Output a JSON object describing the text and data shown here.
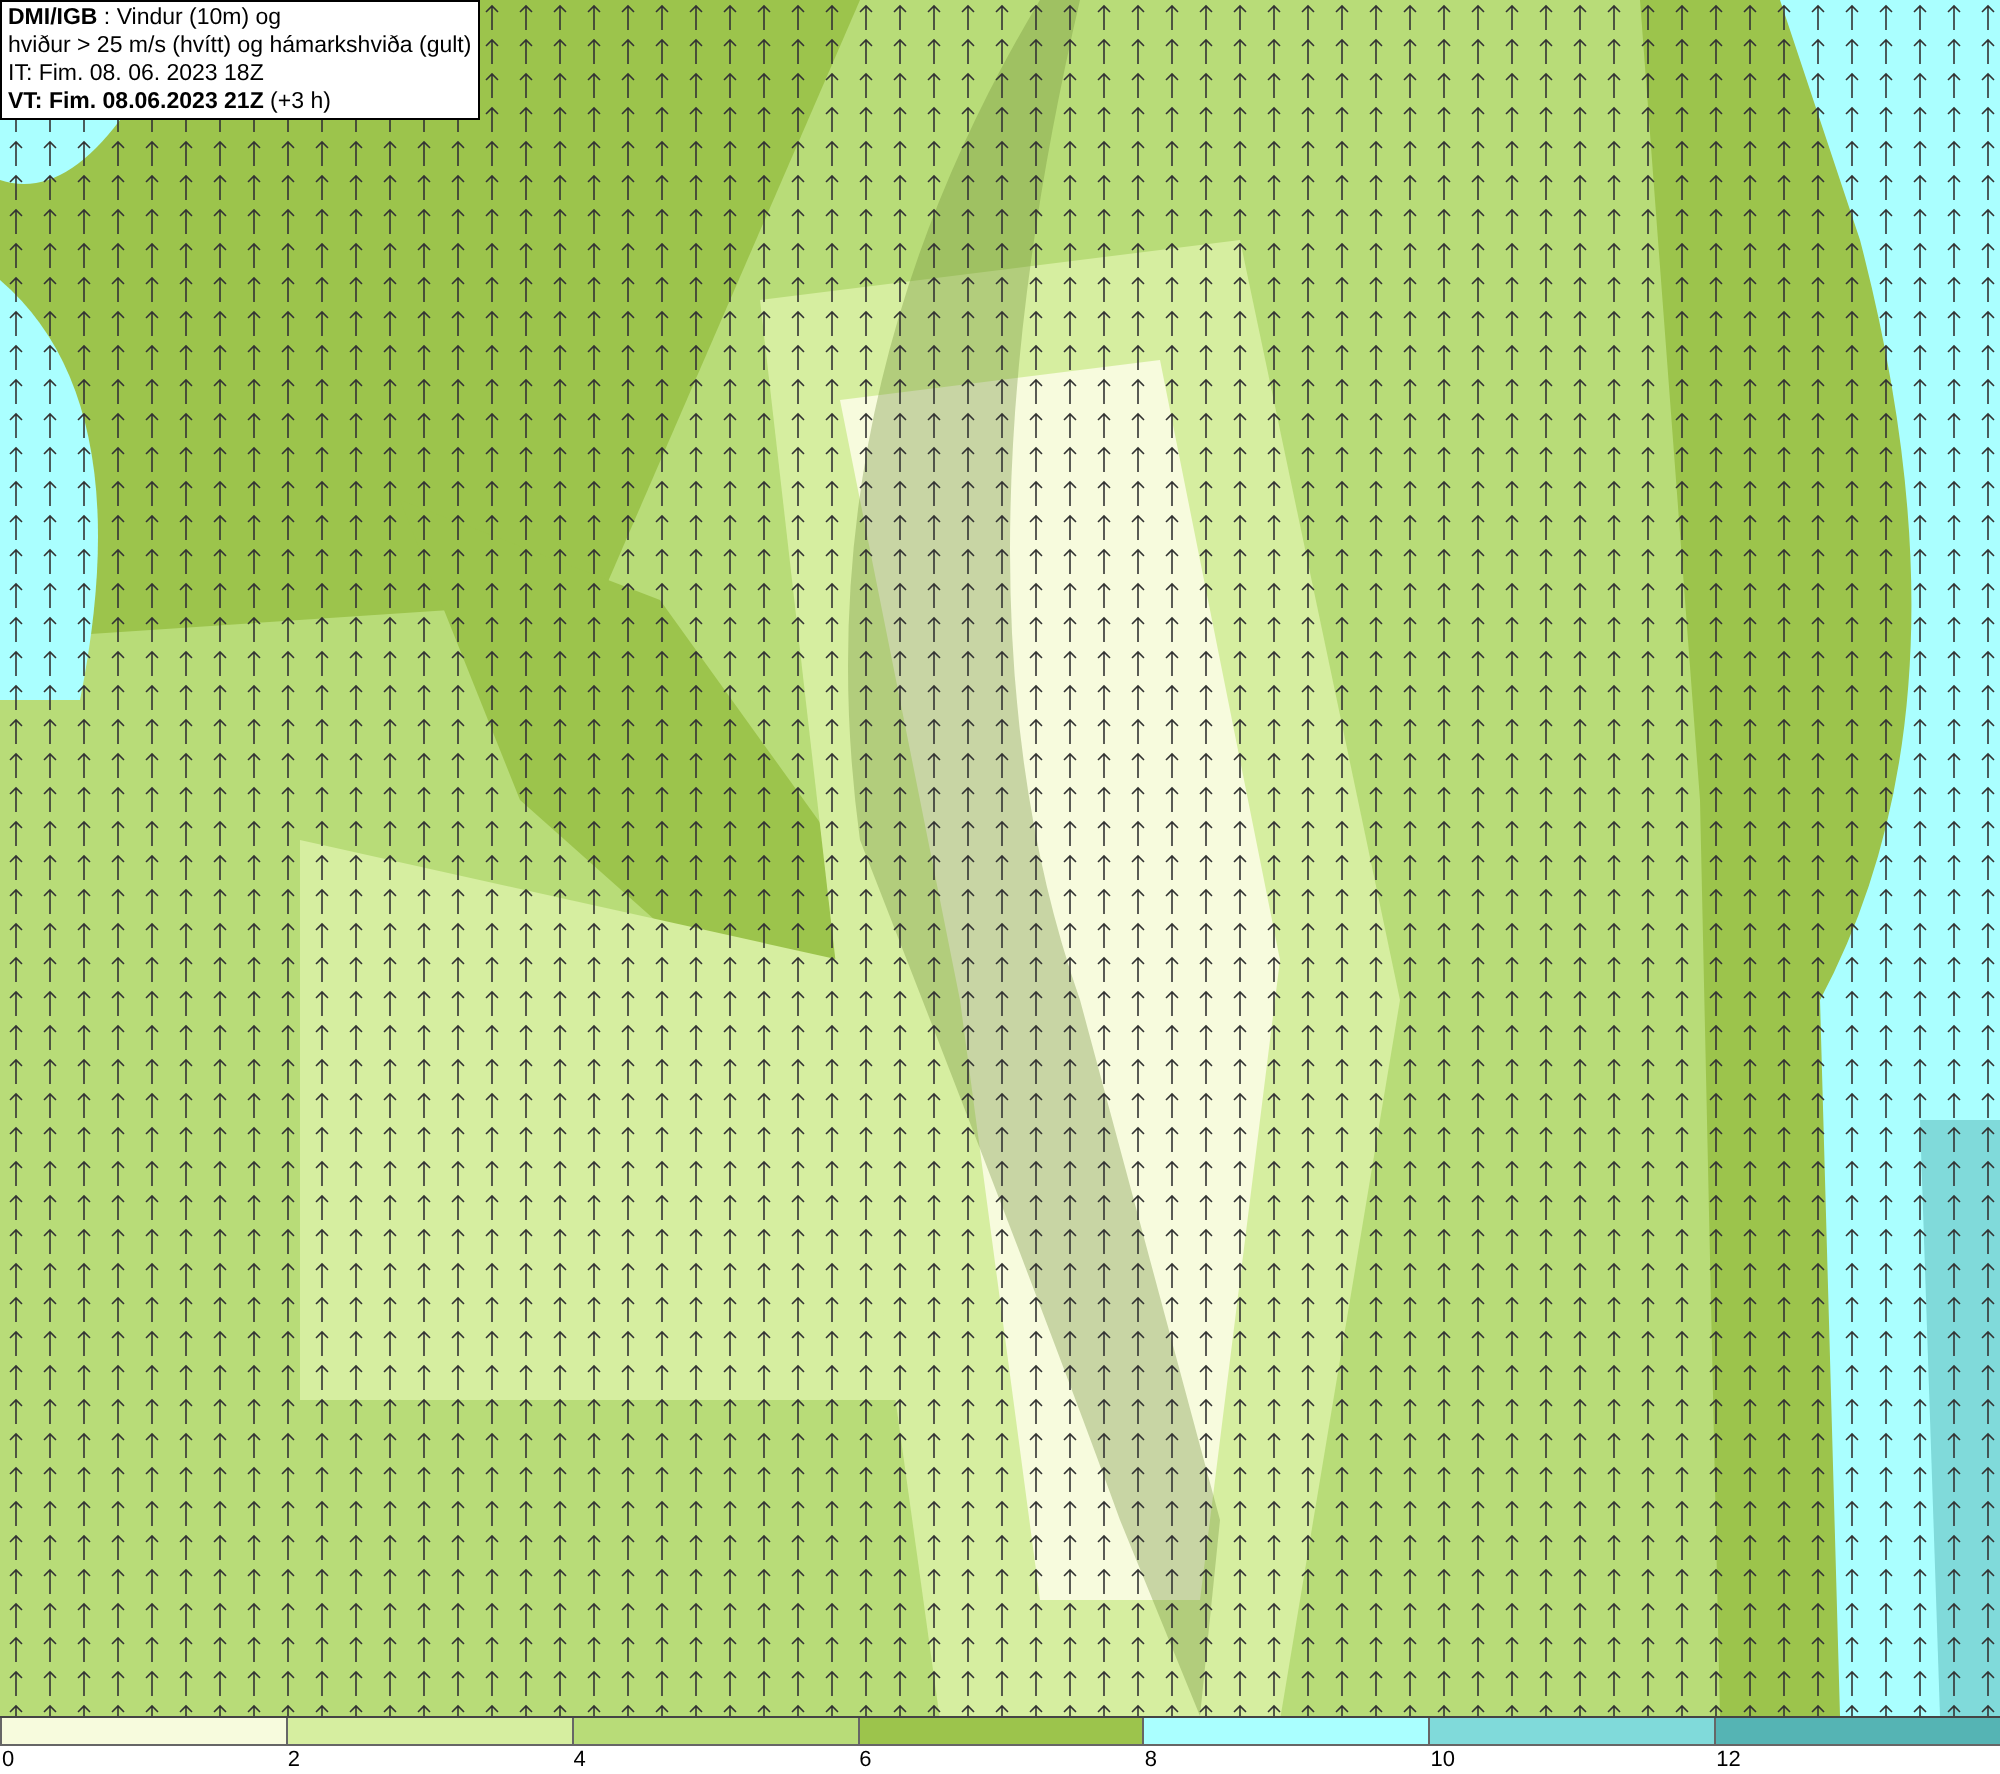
{
  "header": {
    "lines": [
      "**DMI/IGB** : Vindur (10m) og",
      "hviður > 25 m/s (hvítt) og hámarkshviða (gult)",
      "IT: Fim. 08. 06. 2023 18Z",
      "**VT: Fim. 08.06.2023 21Z** (+3 h)"
    ]
  },
  "legend": [
    {
      "label": "0",
      "color": "#f7fbdd"
    },
    {
      "label": "2",
      "color": "#d6eea0"
    },
    {
      "label": "4",
      "color": "#b8dc78"
    },
    {
      "label": "6",
      "color": "#9cc44c"
    },
    {
      "label": "8",
      "color": "#aaffff"
    },
    {
      "label": "10",
      "color": "#80dada"
    },
    {
      "label": "12",
      "color": "#55b4b4"
    }
  ]
}
